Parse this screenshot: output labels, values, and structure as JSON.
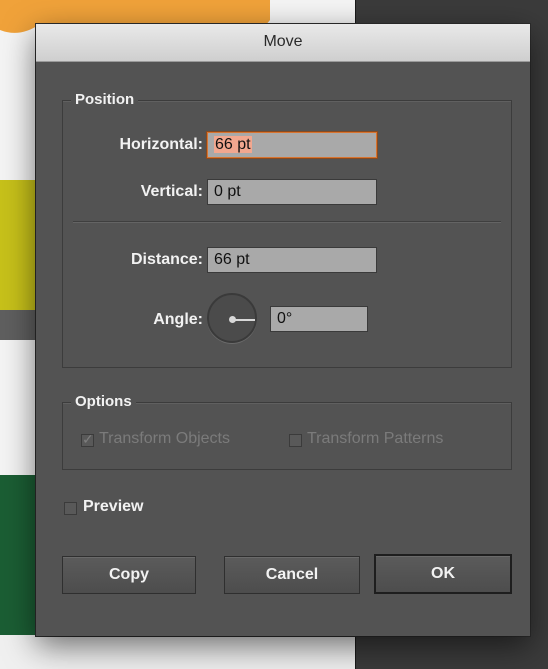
{
  "dialog": {
    "title": "Move"
  },
  "position": {
    "group_label": "Position",
    "horizontal": {
      "label": "Horizontal:",
      "value": "66 pt"
    },
    "vertical": {
      "label": "Vertical:",
      "value": "0 pt"
    },
    "distance": {
      "label": "Distance:",
      "value": "66 pt"
    },
    "angle": {
      "label": "Angle:",
      "value": "0°"
    }
  },
  "options": {
    "group_label": "Options",
    "transform_objects": {
      "label": "Transform Objects",
      "checked": true,
      "enabled": false
    },
    "transform_patterns": {
      "label": "Transform Patterns",
      "checked": false,
      "enabled": false
    }
  },
  "preview": {
    "label": "Preview",
    "checked": false
  },
  "buttons": {
    "copy": "Copy",
    "cancel": "Cancel",
    "ok": "OK"
  },
  "colors": {
    "dialog_bg": "#535353",
    "focus_ring": "#d9742f",
    "selection": "#f2a78f",
    "field_bg": "#a9a9a9"
  }
}
